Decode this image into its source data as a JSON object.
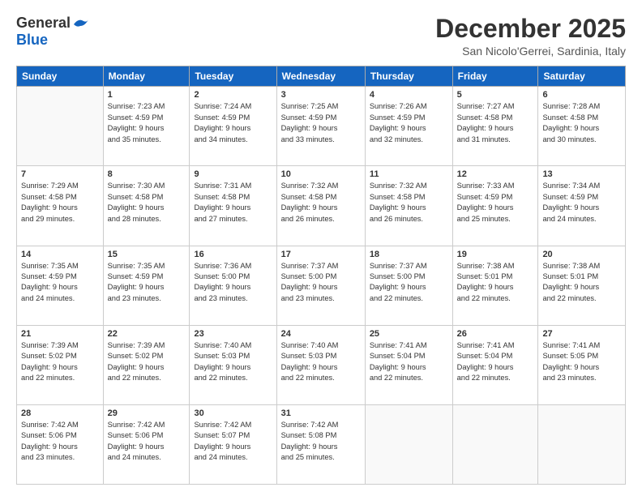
{
  "logo": {
    "general": "General",
    "blue": "Blue"
  },
  "title": "December 2025",
  "location": "San Nicolo'Gerrei, Sardinia, Italy",
  "days_of_week": [
    "Sunday",
    "Monday",
    "Tuesday",
    "Wednesday",
    "Thursday",
    "Friday",
    "Saturday"
  ],
  "weeks": [
    [
      {
        "day": "",
        "info": ""
      },
      {
        "day": "1",
        "info": "Sunrise: 7:23 AM\nSunset: 4:59 PM\nDaylight: 9 hours\nand 35 minutes."
      },
      {
        "day": "2",
        "info": "Sunrise: 7:24 AM\nSunset: 4:59 PM\nDaylight: 9 hours\nand 34 minutes."
      },
      {
        "day": "3",
        "info": "Sunrise: 7:25 AM\nSunset: 4:59 PM\nDaylight: 9 hours\nand 33 minutes."
      },
      {
        "day": "4",
        "info": "Sunrise: 7:26 AM\nSunset: 4:59 PM\nDaylight: 9 hours\nand 32 minutes."
      },
      {
        "day": "5",
        "info": "Sunrise: 7:27 AM\nSunset: 4:58 PM\nDaylight: 9 hours\nand 31 minutes."
      },
      {
        "day": "6",
        "info": "Sunrise: 7:28 AM\nSunset: 4:58 PM\nDaylight: 9 hours\nand 30 minutes."
      }
    ],
    [
      {
        "day": "7",
        "info": "Sunrise: 7:29 AM\nSunset: 4:58 PM\nDaylight: 9 hours\nand 29 minutes."
      },
      {
        "day": "8",
        "info": "Sunrise: 7:30 AM\nSunset: 4:58 PM\nDaylight: 9 hours\nand 28 minutes."
      },
      {
        "day": "9",
        "info": "Sunrise: 7:31 AM\nSunset: 4:58 PM\nDaylight: 9 hours\nand 27 minutes."
      },
      {
        "day": "10",
        "info": "Sunrise: 7:32 AM\nSunset: 4:58 PM\nDaylight: 9 hours\nand 26 minutes."
      },
      {
        "day": "11",
        "info": "Sunrise: 7:32 AM\nSunset: 4:58 PM\nDaylight: 9 hours\nand 26 minutes."
      },
      {
        "day": "12",
        "info": "Sunrise: 7:33 AM\nSunset: 4:59 PM\nDaylight: 9 hours\nand 25 minutes."
      },
      {
        "day": "13",
        "info": "Sunrise: 7:34 AM\nSunset: 4:59 PM\nDaylight: 9 hours\nand 24 minutes."
      }
    ],
    [
      {
        "day": "14",
        "info": "Sunrise: 7:35 AM\nSunset: 4:59 PM\nDaylight: 9 hours\nand 24 minutes."
      },
      {
        "day": "15",
        "info": "Sunrise: 7:35 AM\nSunset: 4:59 PM\nDaylight: 9 hours\nand 23 minutes."
      },
      {
        "day": "16",
        "info": "Sunrise: 7:36 AM\nSunset: 5:00 PM\nDaylight: 9 hours\nand 23 minutes."
      },
      {
        "day": "17",
        "info": "Sunrise: 7:37 AM\nSunset: 5:00 PM\nDaylight: 9 hours\nand 23 minutes."
      },
      {
        "day": "18",
        "info": "Sunrise: 7:37 AM\nSunset: 5:00 PM\nDaylight: 9 hours\nand 22 minutes."
      },
      {
        "day": "19",
        "info": "Sunrise: 7:38 AM\nSunset: 5:01 PM\nDaylight: 9 hours\nand 22 minutes."
      },
      {
        "day": "20",
        "info": "Sunrise: 7:38 AM\nSunset: 5:01 PM\nDaylight: 9 hours\nand 22 minutes."
      }
    ],
    [
      {
        "day": "21",
        "info": "Sunrise: 7:39 AM\nSunset: 5:02 PM\nDaylight: 9 hours\nand 22 minutes."
      },
      {
        "day": "22",
        "info": "Sunrise: 7:39 AM\nSunset: 5:02 PM\nDaylight: 9 hours\nand 22 minutes."
      },
      {
        "day": "23",
        "info": "Sunrise: 7:40 AM\nSunset: 5:03 PM\nDaylight: 9 hours\nand 22 minutes."
      },
      {
        "day": "24",
        "info": "Sunrise: 7:40 AM\nSunset: 5:03 PM\nDaylight: 9 hours\nand 22 minutes."
      },
      {
        "day": "25",
        "info": "Sunrise: 7:41 AM\nSunset: 5:04 PM\nDaylight: 9 hours\nand 22 minutes."
      },
      {
        "day": "26",
        "info": "Sunrise: 7:41 AM\nSunset: 5:04 PM\nDaylight: 9 hours\nand 22 minutes."
      },
      {
        "day": "27",
        "info": "Sunrise: 7:41 AM\nSunset: 5:05 PM\nDaylight: 9 hours\nand 23 minutes."
      }
    ],
    [
      {
        "day": "28",
        "info": "Sunrise: 7:42 AM\nSunset: 5:06 PM\nDaylight: 9 hours\nand 23 minutes."
      },
      {
        "day": "29",
        "info": "Sunrise: 7:42 AM\nSunset: 5:06 PM\nDaylight: 9 hours\nand 24 minutes."
      },
      {
        "day": "30",
        "info": "Sunrise: 7:42 AM\nSunset: 5:07 PM\nDaylight: 9 hours\nand 24 minutes."
      },
      {
        "day": "31",
        "info": "Sunrise: 7:42 AM\nSunset: 5:08 PM\nDaylight: 9 hours\nand 25 minutes."
      },
      {
        "day": "",
        "info": ""
      },
      {
        "day": "",
        "info": ""
      },
      {
        "day": "",
        "info": ""
      }
    ]
  ]
}
